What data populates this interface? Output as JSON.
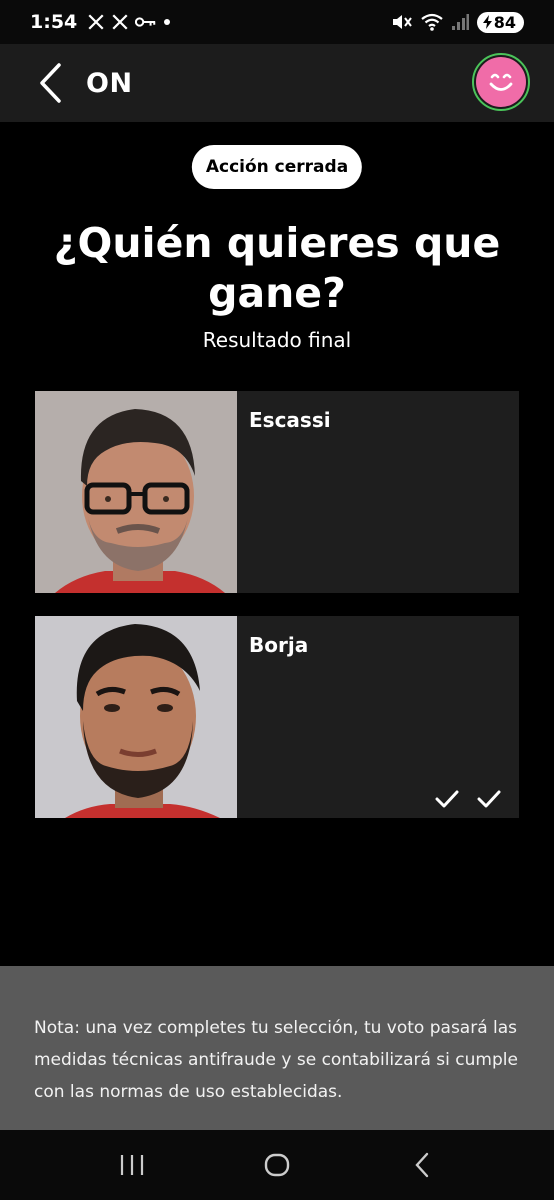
{
  "status_bar": {
    "time": "1:54",
    "left_icons": [
      "x-logo-icon",
      "x-logo-icon",
      "key-icon",
      "dot-icon"
    ],
    "battery": "84"
  },
  "header": {
    "title": "ON",
    "back_icon": "back-arrow-icon",
    "avatar_icon": "smiley-icon",
    "avatar_color": "#f06ca8"
  },
  "main": {
    "badge": "Acción cerrada",
    "question": "¿Quién quieres que gane?",
    "subtitle": "Resultado final",
    "options": [
      {
        "name": "Escassi",
        "selected": false
      },
      {
        "name": "Borja",
        "selected": true
      }
    ]
  },
  "note": {
    "text": "Nota: una vez completes tu selección, tu voto pasará las medidas técnicas antifraude y se contabilizará si cumple con las normas de uso establecidas."
  },
  "nav": {
    "icons": [
      "recent-apps-icon",
      "home-icon",
      "back-icon"
    ]
  }
}
